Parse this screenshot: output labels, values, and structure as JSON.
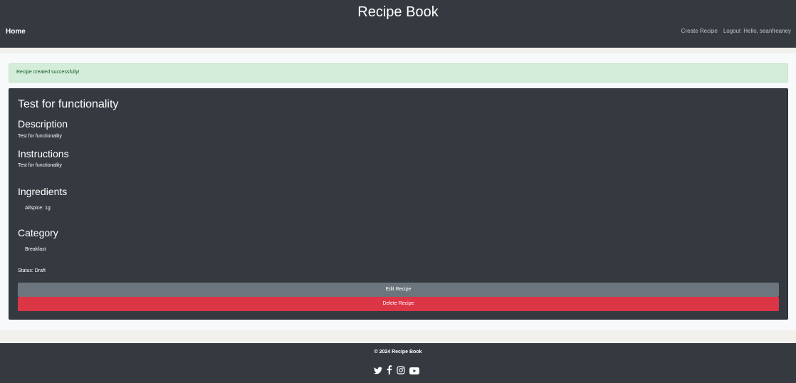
{
  "header": {
    "site_title": "Recipe Book",
    "nav": {
      "home": "Home",
      "create_recipe": "Create Recipe",
      "logout": "Logout",
      "greeting": "Hello, seanfreaney"
    }
  },
  "alert": {
    "message": "Recipe created successfully!"
  },
  "recipe": {
    "title": "Test for functionality",
    "description_heading": "Description",
    "description": "Test for functionality",
    "instructions_heading": "Instructions",
    "instructions": "Test for functionality",
    "ingredients_heading": "Ingredients",
    "ingredients": [
      "Allspice: 1g"
    ],
    "category_heading": "Category",
    "categories": [
      "Breakfast"
    ],
    "status": "Status: Draft",
    "edit_label": "Edit Recipe",
    "delete_label": "Delete Recipe"
  },
  "footer": {
    "copyright": "© 2024 Recipe Book",
    "social_icons": [
      "twitter-icon",
      "facebook-icon",
      "instagram-icon",
      "youtube-icon"
    ]
  },
  "colors": {
    "dark": "#343a40",
    "success_bg": "#d4edda",
    "success_text": "#155724",
    "secondary": "#6c757d",
    "danger": "#dc3545"
  }
}
